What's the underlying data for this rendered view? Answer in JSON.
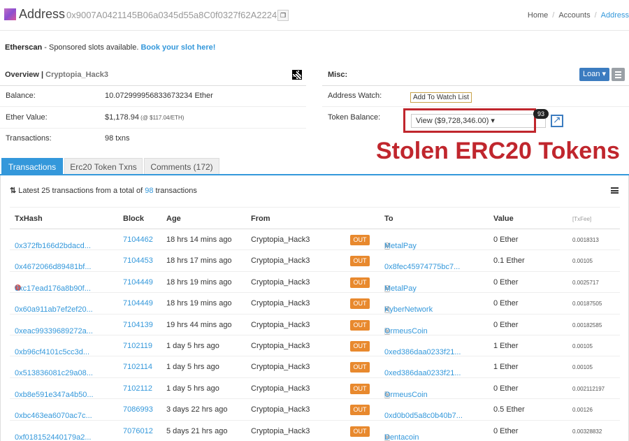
{
  "header": {
    "title": "Address",
    "address": "0x9007A0421145B06a0345d55a8C0f0327f62A2224",
    "breadcrumbs": [
      "Home",
      "Accounts",
      "Address"
    ]
  },
  "sponsor": {
    "brand": "Etherscan",
    "text": " - Sponsored slots available. ",
    "link": "Book your slot here!"
  },
  "overview": {
    "title": "Overview",
    "separator": " | ",
    "name": "Cryptopia_Hack3",
    "rows": [
      {
        "label": "Balance:",
        "value": "10.072999956833673234 Ether",
        "sub": ""
      },
      {
        "label": "Ether Value:",
        "value": "$1,178.94",
        "sub": " (@ $117.04/ETH)"
      },
      {
        "label": "Transactions:",
        "value": "98 txns",
        "sub": ""
      }
    ]
  },
  "misc": {
    "title": "Misc:",
    "loan_label": "Loan ▾",
    "watch_label": "Address Watch:",
    "watch_button": "Add To Watch List",
    "token_label": "Token Balance:",
    "token_value": "View ($9,728,346.00) ▾",
    "token_count": "93",
    "annotation": "Stolen ERC20 Tokens"
  },
  "tabs": [
    "Transactions",
    "Erc20 Token Txns",
    "Comments (172)"
  ],
  "list": {
    "pre": "Latest 25 transactions from a total of ",
    "count": "98",
    "post": " transactions"
  },
  "table": {
    "headers": [
      "TxHash",
      "Block",
      "Age",
      "From",
      "To",
      "Value",
      "[TxFee]"
    ],
    "rows": [
      {
        "hash": "0x372fb166d2bdacd...",
        "block": "7104462",
        "age": "18 hrs 14 mins ago",
        "from": "Cryptopia_Hack3",
        "dir": "OUT",
        "to": "MetalPay",
        "contract": true,
        "value": "0 Ether",
        "fee": "0.0018313",
        "error": false
      },
      {
        "hash": "0x4672066d89481bf...",
        "block": "7104453",
        "age": "18 hrs 17 mins ago",
        "from": "Cryptopia_Hack3",
        "dir": "OUT",
        "to": "0x8fec45974775bc7...",
        "contract": false,
        "value": "0.1 Ether",
        "fee": "0.00105",
        "error": false
      },
      {
        "hash": "0xc17ead176a8b90f...",
        "block": "7104449",
        "age": "18 hrs 19 mins ago",
        "from": "Cryptopia_Hack3",
        "dir": "OUT",
        "to": "MetalPay",
        "contract": true,
        "value": "0 Ether",
        "fee": "0.0025717",
        "error": true
      },
      {
        "hash": "0x60a911ab7ef2ef20...",
        "block": "7104449",
        "age": "18 hrs 19 mins ago",
        "from": "Cryptopia_Hack3",
        "dir": "OUT",
        "to": "KyberNetwork",
        "contract": true,
        "value": "0 Ether",
        "fee": "0.00187505",
        "error": false
      },
      {
        "hash": "0xeac99339689272a...",
        "block": "7104139",
        "age": "19 hrs 44 mins ago",
        "from": "Cryptopia_Hack3",
        "dir": "OUT",
        "to": "OrmeusCoin",
        "contract": true,
        "value": "0 Ether",
        "fee": "0.00182585",
        "error": false
      },
      {
        "hash": "0xb96cf4101c5cc3d...",
        "block": "7102119",
        "age": "1 day 5 hrs ago",
        "from": "Cryptopia_Hack3",
        "dir": "OUT",
        "to": "0xed386daa0233f21...",
        "contract": false,
        "value": "1 Ether",
        "fee": "0.00105",
        "error": false
      },
      {
        "hash": "0x513836081c29a08...",
        "block": "7102114",
        "age": "1 day 5 hrs ago",
        "from": "Cryptopia_Hack3",
        "dir": "OUT",
        "to": "0xed386daa0233f21...",
        "contract": false,
        "value": "1 Ether",
        "fee": "0.00105",
        "error": false
      },
      {
        "hash": "0xb8e591e347a4b50...",
        "block": "7102112",
        "age": "1 day 5 hrs ago",
        "from": "Cryptopia_Hack3",
        "dir": "OUT",
        "to": "OrmeusCoin",
        "contract": true,
        "value": "0 Ether",
        "fee": "0.002112197",
        "error": false
      },
      {
        "hash": "0xbc463ea6070ac7c...",
        "block": "7086993",
        "age": "3 days 22 hrs ago",
        "from": "Cryptopia_Hack3",
        "dir": "OUT",
        "to": "0xd0b0d5a8c0b40b7...",
        "contract": false,
        "value": "0.5 Ether",
        "fee": "0.00126",
        "error": false
      },
      {
        "hash": "0xf018152440179a2...",
        "block": "7076012",
        "age": "5 days 21 hrs ago",
        "from": "Cryptopia_Hack3",
        "dir": "OUT",
        "to": "Dentacoin",
        "contract": true,
        "value": "0 Ether",
        "fee": "0.00328832",
        "error": false
      }
    ]
  }
}
